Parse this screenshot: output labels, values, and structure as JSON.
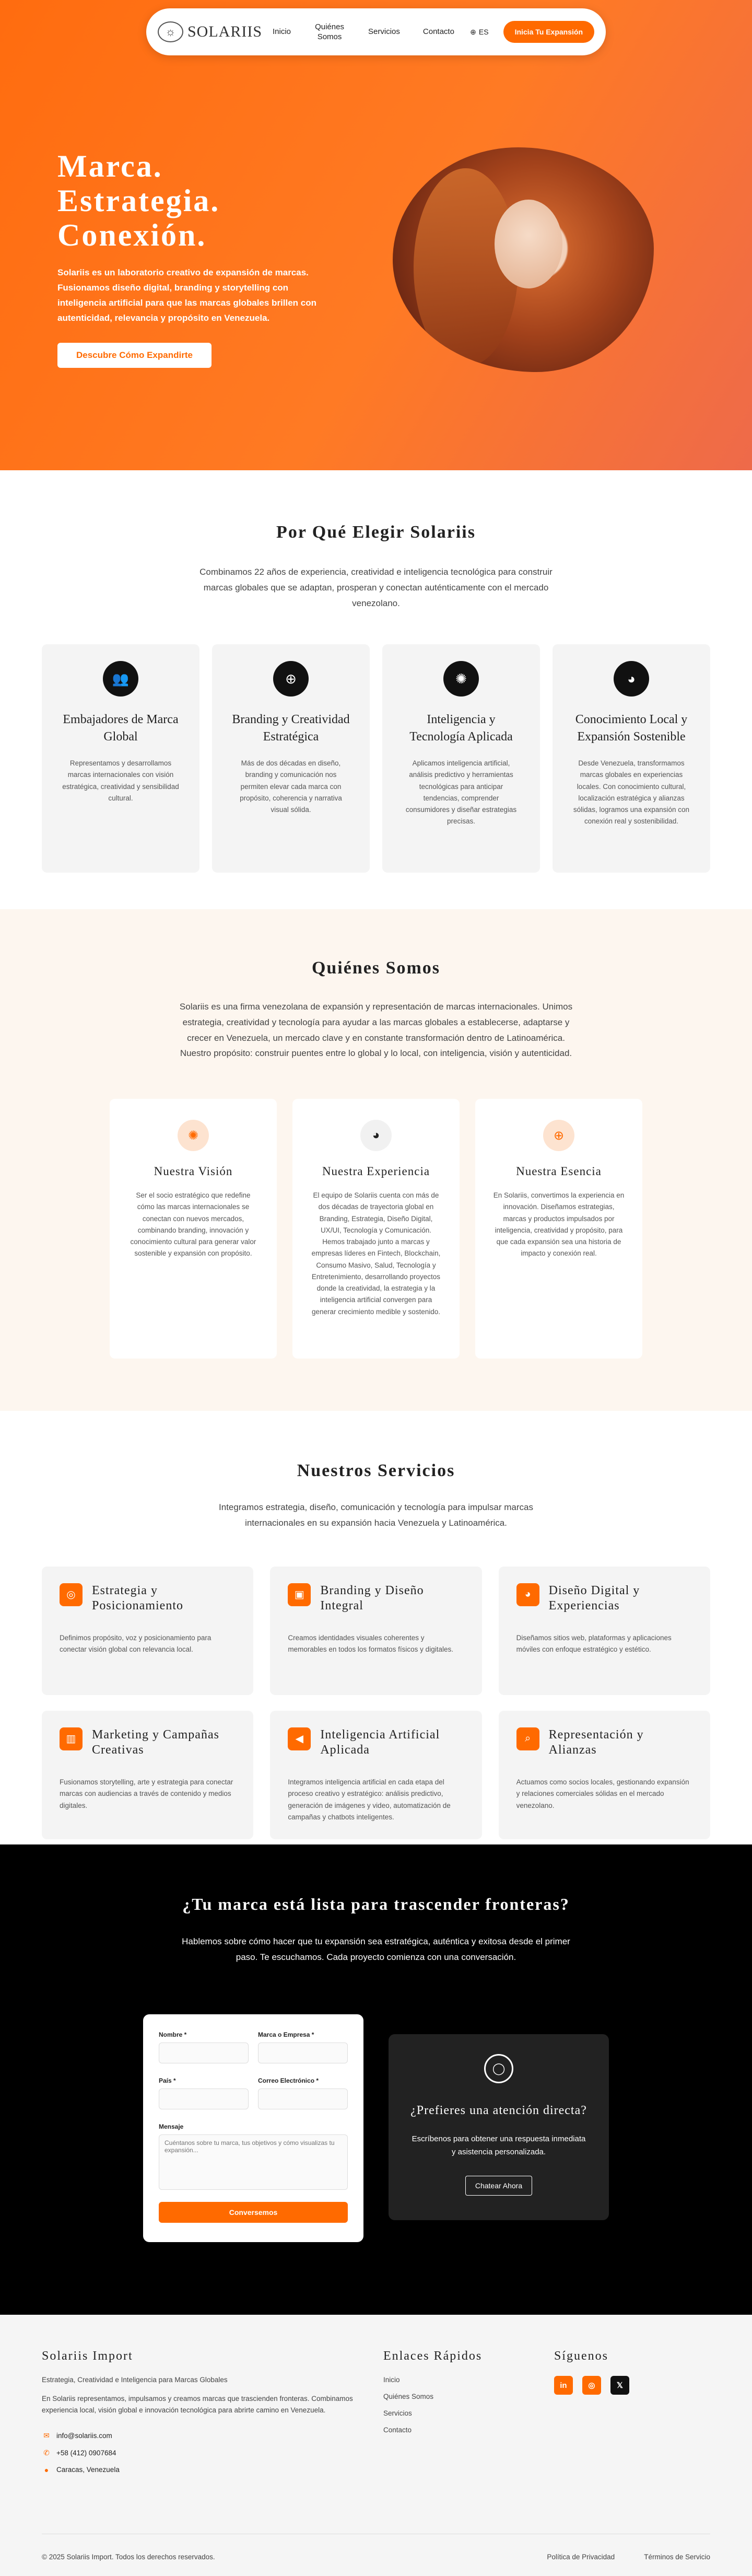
{
  "nav": {
    "logo_text": "SOLARIIS",
    "links": [
      "Inicio",
      "Quiénes Somos",
      "Servicios",
      "Contacto"
    ],
    "lang": "ES",
    "cta": "Inicia Tu Expansión"
  },
  "hero": {
    "title_lines": [
      "Marca.",
      "Estrategia.",
      "Conexión."
    ],
    "description": "Solariis es un laboratorio creativo de expansión de marcas. Fusionamos diseño digital, branding y storytelling con inteligencia artificial para que las marcas globales brillen con autenticidad, relevancia y propósito en Venezuela.",
    "button": "Descubre Cómo Expandirte"
  },
  "why": {
    "title": "Por Qué Elegir Solariis",
    "description": "Combinamos 22 años de experiencia, creatividad e inteligencia tecnológica para construir marcas globales que se adaptan, prosperan y conectan auténticamente con el mercado venezolano.",
    "cards": [
      {
        "icon": "users-icon",
        "title": "Embajadores de Marca Global",
        "text": "Representamos y desarrollamos marcas internacionales con visión estratégica, creatividad y sensibilidad cultural."
      },
      {
        "icon": "globe-icon",
        "title": "Branding y Creatividad Estratégica",
        "text": "Más de dos décadas en diseño, branding y comunicación nos permiten elevar cada marca con propósito, coherencia y narrativa visual sólida."
      },
      {
        "icon": "brain-icon",
        "title": "Inteligencia y Tecnología Aplicada",
        "text": "Aplicamos inteligencia artificial, análisis predictivo y herramientas tecnológicas para anticipar tendencias, comprender consumidores y diseñar estrategias precisas."
      },
      {
        "icon": "palette-icon",
        "title": "Conocimiento Local y Expansión Sostenible",
        "text": "Desde Venezuela, transformamos marcas globales en experiencias locales. Con conocimiento cultural, localización estratégica y alianzas sólidas, logramos una expansión con conexión real y sostenibilidad."
      }
    ]
  },
  "about": {
    "title": "Quiénes Somos",
    "description": "Solariis es una firma venezolana de expansión y representación de marcas internacionales. Unimos estrategia, creatividad y tecnología para ayudar a las marcas globales a establecerse, adaptarse y crecer en Venezuela, un mercado clave y en constante transformación dentro de Latinoamérica. Nuestro propósito: construir puentes entre lo global y lo local, con inteligencia, visión y autenticidad.",
    "cards": [
      {
        "icon": "brain-icon",
        "title": "Nuestra Visión",
        "text": "Ser el socio estratégico que redefine cómo las marcas internacionales se conectan con nuevos mercados, combinando branding, innovación y conocimiento cultural para generar valor sostenible y expansión con propósito."
      },
      {
        "icon": "palette-icon",
        "title": "Nuestra Experiencia",
        "text": "El equipo de Solariis cuenta con más de dos décadas de trayectoria global en Branding, Estrategia, Diseño Digital, UX/UI, Tecnología y Comunicación. Hemos trabajado junto a marcas y empresas líderes en Fintech, Blockchain, Consumo Masivo, Salud, Tecnología y Entretenimiento, desarrollando proyectos donde la creatividad, la estrategia y la inteligencia artificial convergen para generar crecimiento medible y sostenido."
      },
      {
        "icon": "globe-icon",
        "title": "Nuestra Esencia",
        "text": "En Solariis, convertimos la experiencia en innovación. Diseñamos estrategias, marcas y productos impulsados por inteligencia, creatividad y propósito, para que cada expansión sea una historia de impacto y conexión real."
      }
    ]
  },
  "services": {
    "title": "Nuestros Servicios",
    "description": "Integramos estrategia, diseño, comunicación y tecnología para impulsar marcas internacionales en su expansión hacia Venezuela y Latinoamérica.",
    "cards": [
      {
        "icon": "target-icon",
        "title": "Estrategia y Posicionamiento",
        "text": "Definimos propósito, voz y posicionamiento para conectar visión global con relevancia local."
      },
      {
        "icon": "truck-icon",
        "title": "Branding y Diseño Integral",
        "text": "Creamos identidades visuales coherentes y memorables en todos los formatos físicos y digitales."
      },
      {
        "icon": "palette-icon",
        "title": "Diseño Digital y Experiencias",
        "text": "Diseñamos sitios web, plataformas y aplicaciones móviles con enfoque estratégico y estético."
      },
      {
        "icon": "chart-icon",
        "title": "Marketing y Campañas Creativas",
        "text": "Fusionamos storytelling, arte y estrategia para conectar marcas con audiencias a través de contenido y medios digitales."
      },
      {
        "icon": "megaphone-icon",
        "title": "Inteligencia Artificial Aplicada",
        "text": "Integramos inteligencia artificial en cada etapa del proceso creativo y estratégico: análisis predictivo, generación de imágenes y video, automatización de campañas y chatbots inteligentes."
      },
      {
        "icon": "search-icon",
        "title": "Representación y Alianzas",
        "text": "Actuamos como socios locales, gestionando expansión y relaciones comerciales sólidas en el mercado venezolano."
      }
    ]
  },
  "cta": {
    "title": "¿Tu marca está lista para trascender fronteras?",
    "description": "Hablemos sobre cómo hacer que tu expansión sea estratégica, auténtica y exitosa desde el primer paso. Te escuchamos. Cada proyecto comienza con una conversación.",
    "form": {
      "name_label": "Nombre *",
      "company_label": "Marca o Empresa *",
      "country_label": "País *",
      "email_label": "Correo Electrónico *",
      "message_label": "Mensaje",
      "message_placeholder": "Cuéntanos sobre tu marca, tus objetivos y cómo visualizas tu expansión...",
      "submit": "Conversemos"
    },
    "alt": {
      "title": "¿Prefieres una atención directa?",
      "text": "Escríbenos para obtener una respuesta inmediata y asistencia personalizada.",
      "button": "Chatear Ahora"
    }
  },
  "footer": {
    "brand": "Solariis Import",
    "tagline": "Estrategia, Creatividad e Inteligencia para Marcas Globales",
    "about": "En Solariis representamos, impulsamos y creamos marcas que trascienden fronteras. Combinamos experiencia local, visión global e innovación tecnológica para abrirte camino en Venezuela.",
    "email": "info@solariis.com",
    "phone": "+58 (412) 0907684",
    "location": "Caracas, Venezuela",
    "links_title": "Enlaces Rápidos",
    "links": [
      "Inicio",
      "Quiénes Somos",
      "Servicios",
      "Contacto"
    ],
    "social_title": "Síguenos",
    "socials": [
      {
        "icon": "linkedin-icon",
        "glyph": "in"
      },
      {
        "icon": "instagram-icon",
        "glyph": "◎"
      },
      {
        "icon": "twitter-icon",
        "glyph": "𝕏"
      }
    ],
    "copyright": "© 2025 Solariis Import. Todos los derechos reservados.",
    "privacy": "Política de Privacidad",
    "terms": "Términos de Servicio"
  },
  "colors": {
    "accent": "#ff6a00",
    "hero_start": "#ff6c0f",
    "hero_end": "#ee6a4a",
    "about_bg": "#fdf6ef",
    "dark": "#000000"
  }
}
